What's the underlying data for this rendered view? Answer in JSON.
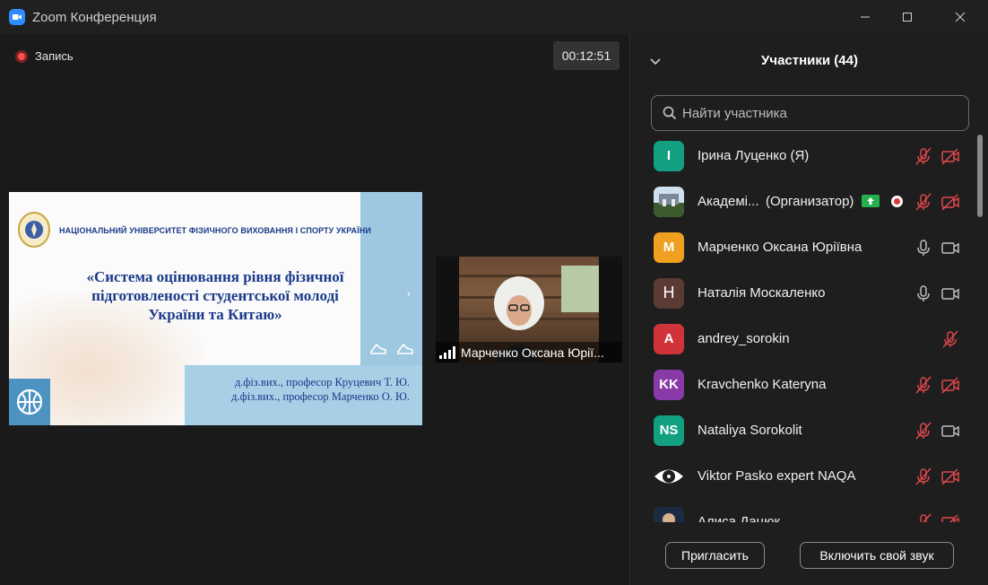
{
  "window": {
    "title": "Zoom Конференция"
  },
  "stage": {
    "recording_label": "Запись",
    "timer": "00:12:51"
  },
  "slide": {
    "university": "НАЦІОНАЛЬНИЙ УНІВЕРСИТЕТ ФІЗИЧНОГО ВИХОВАННЯ І СПОРТУ УКРАЇНИ",
    "title_line1": "«Система оцінювання рівня фізичної",
    "title_line2": "підготовленості студентської молоді",
    "title_line3": "України та Китаю»",
    "author1": "д.фіз.вих., професор Круцевич Т. Ю.",
    "author2": "д.фіз.вих., професор Марченко О. Ю.",
    "arrow": "›"
  },
  "video": {
    "name": "Марченко Оксана Юрії..."
  },
  "panel": {
    "title": "Участники (44)",
    "search_placeholder": "Найти участника",
    "participants": [
      {
        "name": "Ірина Луценко (Я)",
        "initials": "I",
        "color": "#12a081",
        "mic": "muted",
        "video": "off"
      },
      {
        "name": "Академі...",
        "role": "(Организатор)",
        "initials": "",
        "color": "#4a6a3a",
        "mic": "muted",
        "video": "off",
        "sharing": true,
        "recording": true
      },
      {
        "name": "Марченко Оксана Юріївна",
        "initials": "M",
        "color": "#f0a020",
        "mic": "on",
        "video": "on"
      },
      {
        "name": "Наталія Москаленко",
        "initials": "H",
        "color": "#5a3a32",
        "mic": "on",
        "video": "on"
      },
      {
        "name": "andrey_sorokin",
        "initials": "A",
        "color": "#d0343a",
        "mic": "muted"
      },
      {
        "name": "Kravchenko Kateryna",
        "initials": "KK",
        "color": "#8a3aa8",
        "mic": "muted",
        "video": "off"
      },
      {
        "name": "Nataliya Sorokolit",
        "initials": "NS",
        "color": "#12a081",
        "mic": "muted",
        "video": "on"
      },
      {
        "name": "Viktor Pasko expert NAQA",
        "initials": "",
        "color": "#ffffff",
        "mic": "muted",
        "video": "off"
      },
      {
        "name": "Алиса Дацюк",
        "initials": "",
        "color": "#2a3a55",
        "mic": "muted",
        "video": "off"
      }
    ],
    "invite_button": "Пригласить",
    "unmute_button": "Включить свой звук"
  }
}
